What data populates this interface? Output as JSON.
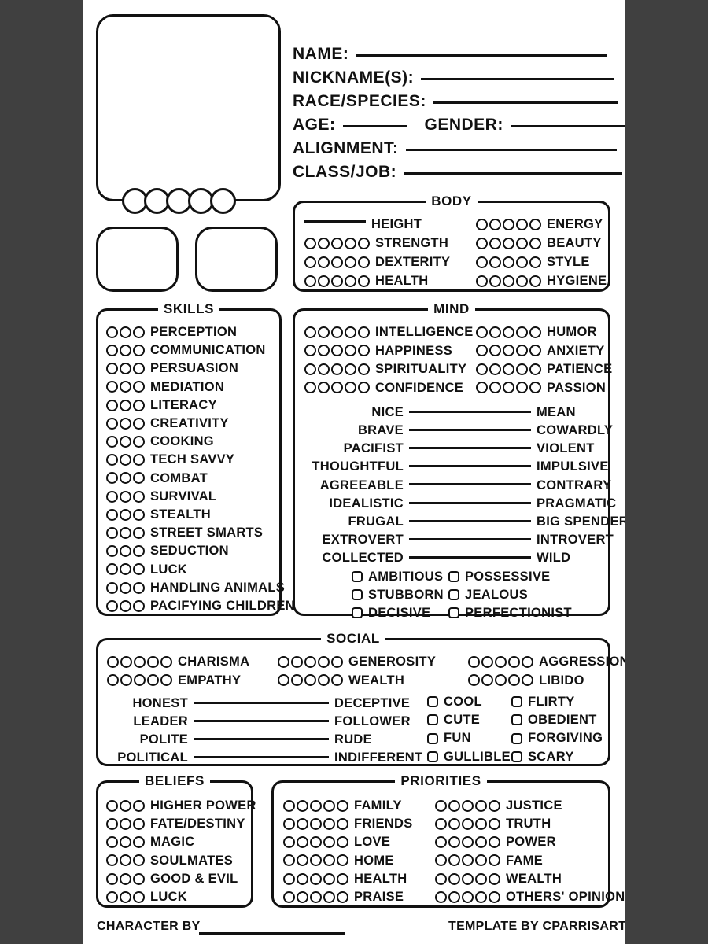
{
  "sheet": {
    "footer": {
      "character_by_label": "CHARACTER BY",
      "template_by": "TEMPLATE BY CPARRISART"
    }
  },
  "header": {
    "fields": [
      {
        "label": "NAME:",
        "line_width": 320
      },
      {
        "label": "NICKNAME(S):",
        "line_width": 245
      },
      {
        "label": "RACE/SPECIES:",
        "line_width": 235
      },
      {
        "label": "ALIGNMENT:",
        "line_width": 268
      },
      {
        "label": "CLASS/JOB:",
        "line_width": 278
      }
    ],
    "age_label": "AGE:",
    "age_line_width": 82,
    "gender_label": "GENDER:",
    "gender_line_width": 150
  },
  "body": {
    "title": "BODY",
    "left": [
      {
        "label": "HEIGHT",
        "pips": 0,
        "write_in": true
      },
      {
        "label": "STRENGTH",
        "pips": 5
      },
      {
        "label": "DEXTERITY",
        "pips": 5
      },
      {
        "label": "HEALTH",
        "pips": 5
      }
    ],
    "right": [
      {
        "label": "ENERGY",
        "pips": 5
      },
      {
        "label": "BEAUTY",
        "pips": 5
      },
      {
        "label": "STYLE",
        "pips": 5
      },
      {
        "label": "HYGIENE",
        "pips": 5
      }
    ]
  },
  "skills": {
    "title": "SKILLS",
    "items": [
      {
        "label": "PERCEPTION",
        "pips": 3
      },
      {
        "label": "COMMUNICATION",
        "pips": 3
      },
      {
        "label": "PERSUASION",
        "pips": 3
      },
      {
        "label": "MEDIATION",
        "pips": 3
      },
      {
        "label": "LITERACY",
        "pips": 3
      },
      {
        "label": "CREATIVITY",
        "pips": 3
      },
      {
        "label": "COOKING",
        "pips": 3
      },
      {
        "label": "TECH SAVVY",
        "pips": 3
      },
      {
        "label": "COMBAT",
        "pips": 3
      },
      {
        "label": "SURVIVAL",
        "pips": 3
      },
      {
        "label": "STEALTH",
        "pips": 3
      },
      {
        "label": "STREET SMARTS",
        "pips": 3
      },
      {
        "label": "SEDUCTION",
        "pips": 3
      },
      {
        "label": "LUCK",
        "pips": 3
      },
      {
        "label": "HANDLING ANIMALS",
        "pips": 3
      },
      {
        "label": "PACIFYING CHILDREN",
        "pips": 3
      }
    ]
  },
  "mind": {
    "title": "MIND",
    "left": [
      {
        "label": "INTELLIGENCE",
        "pips": 5
      },
      {
        "label": "HAPPINESS",
        "pips": 5
      },
      {
        "label": "SPIRITUALITY",
        "pips": 5
      },
      {
        "label": "CONFIDENCE",
        "pips": 5
      }
    ],
    "right": [
      {
        "label": "HUMOR",
        "pips": 5
      },
      {
        "label": "ANXIETY",
        "pips": 5
      },
      {
        "label": "PATIENCE",
        "pips": 5
      },
      {
        "label": "PASSION",
        "pips": 5
      }
    ],
    "sliders": [
      {
        "left": "NICE",
        "right": "MEAN"
      },
      {
        "left": "BRAVE",
        "right": "COWARDLY"
      },
      {
        "left": "PACIFIST",
        "right": "VIOLENT"
      },
      {
        "left": "THOUGHTFUL",
        "right": "IMPULSIVE"
      },
      {
        "left": "AGREEABLE",
        "right": "CONTRARY"
      },
      {
        "left": "IDEALISTIC",
        "right": "PRAGMATIC"
      },
      {
        "left": "FRUGAL",
        "right": "BIG SPENDER"
      },
      {
        "left": "EXTROVERT",
        "right": "INTROVERT"
      },
      {
        "left": "COLLECTED",
        "right": "WILD"
      }
    ],
    "checkboxes_left": [
      "AMBITIOUS",
      "STUBBORN",
      "DECISIVE"
    ],
    "checkboxes_right": [
      "POSSESSIVE",
      "JEALOUS",
      "PERFECTIONIST"
    ]
  },
  "social": {
    "title": "SOCIAL",
    "col1": [
      {
        "label": "CHARISMA",
        "pips": 5
      },
      {
        "label": "EMPATHY",
        "pips": 5
      }
    ],
    "col2": [
      {
        "label": "GENEROSITY",
        "pips": 5
      },
      {
        "label": "WEALTH",
        "pips": 5
      }
    ],
    "col3": [
      {
        "label": "AGGRESSION",
        "pips": 5
      },
      {
        "label": "LIBIDO",
        "pips": 5
      }
    ],
    "sliders": [
      {
        "left": "HONEST",
        "right": "DECEPTIVE"
      },
      {
        "left": "LEADER",
        "right": "FOLLOWER"
      },
      {
        "left": "POLITE",
        "right": "RUDE"
      },
      {
        "left": "POLITICAL",
        "right": "INDIFFERENT"
      }
    ],
    "checkboxes_left": [
      "COOL",
      "CUTE",
      "FUN",
      "GULLIBLE"
    ],
    "checkboxes_right": [
      "FLIRTY",
      "OBEDIENT",
      "FORGIVING",
      "SCARY"
    ]
  },
  "beliefs": {
    "title": "BELIEFS",
    "items": [
      {
        "label": "HIGHER POWER",
        "pips": 3
      },
      {
        "label": "FATE/DESTINY",
        "pips": 3
      },
      {
        "label": "MAGIC",
        "pips": 3
      },
      {
        "label": "SOULMATES",
        "pips": 3
      },
      {
        "label": "GOOD & EVIL",
        "pips": 3
      },
      {
        "label": "LUCK",
        "pips": 3
      }
    ]
  },
  "priorities": {
    "title": "PRIORITIES",
    "left": [
      {
        "label": "FAMILY",
        "pips": 5
      },
      {
        "label": "FRIENDS",
        "pips": 5
      },
      {
        "label": "LOVE",
        "pips": 5
      },
      {
        "label": "HOME",
        "pips": 5
      },
      {
        "label": "HEALTH",
        "pips": 5
      },
      {
        "label": "PRAISE",
        "pips": 5
      }
    ],
    "right": [
      {
        "label": "JUSTICE",
        "pips": 5
      },
      {
        "label": "TRUTH",
        "pips": 5
      },
      {
        "label": "POWER",
        "pips": 5
      },
      {
        "label": "FAME",
        "pips": 5
      },
      {
        "label": "WEALTH",
        "pips": 5
      },
      {
        "label": "OTHERS' OPINIONS",
        "pips": 5
      }
    ]
  }
}
